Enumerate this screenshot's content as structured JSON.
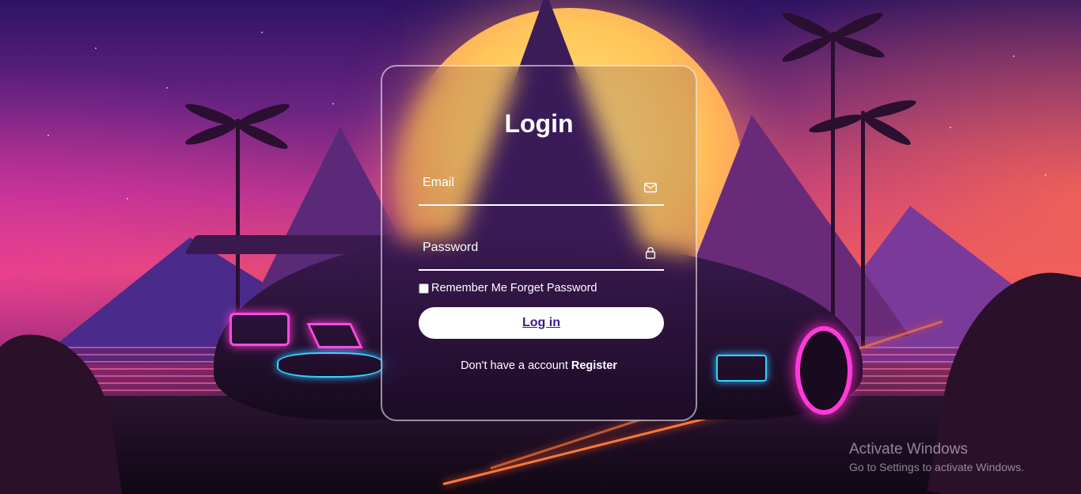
{
  "login": {
    "title": "Login",
    "email_label": "Email",
    "email_icon": "mail-icon",
    "password_label": "Password",
    "password_icon": "lock-icon",
    "remember_label": "Remember Me",
    "forget_label": "Forget Password",
    "button_label": "Log in",
    "no_account_text": "Don't have a account",
    "register_label": "Register"
  },
  "watermark": {
    "title": "Activate Windows",
    "subtitle": "Go to Settings to activate Windows."
  },
  "colors": {
    "button_text": "#3a1a8a",
    "card_border": "#ffffff",
    "neon_pink": "#ff3ad0",
    "neon_blue": "#3ad0ff"
  }
}
